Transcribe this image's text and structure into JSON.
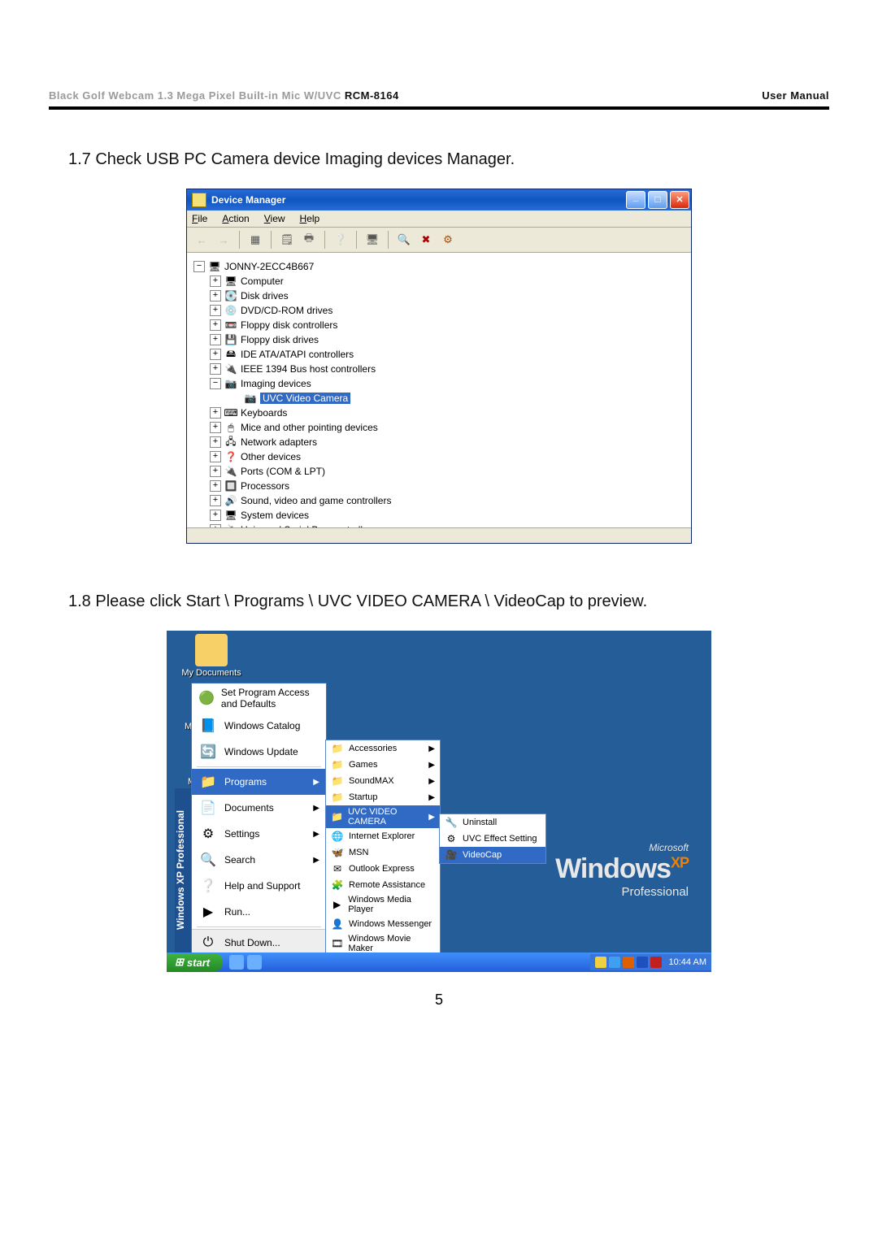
{
  "header": {
    "left_grey": "Black Golf Webcam 1.3 Mega Pixel Built-in Mic W/UVC ",
    "model": "RCM-8164",
    "right": "User Manual"
  },
  "step17": "1.7 Check USB PC Camera device Imaging devices Manager.",
  "device_manager": {
    "title": "Device Manager",
    "menus": {
      "file": "File",
      "action": "Action",
      "view": "View",
      "help": "Help"
    },
    "root": "JONNY-2ECC4B667",
    "items": [
      {
        "label": "Computer",
        "icon": "🖥"
      },
      {
        "label": "Disk drives",
        "icon": "💽"
      },
      {
        "label": "DVD/CD-ROM drives",
        "icon": "💿"
      },
      {
        "label": "Floppy disk controllers",
        "icon": "📼"
      },
      {
        "label": "Floppy disk drives",
        "icon": "💾"
      },
      {
        "label": "IDE ATA/ATAPI controllers",
        "icon": "🖴"
      },
      {
        "label": "IEEE 1394 Bus host controllers",
        "icon": "🔌"
      }
    ],
    "imaging_label": "Imaging devices",
    "imaging_icon": "📷",
    "selected": "UVC Video Camera",
    "items2": [
      {
        "label": "Keyboards",
        "icon": "⌨"
      },
      {
        "label": "Mice and other pointing devices",
        "icon": "🖱"
      },
      {
        "label": "Network adapters",
        "icon": "🖧"
      },
      {
        "label": "Other devices",
        "icon": "❓"
      },
      {
        "label": "Ports (COM & LPT)",
        "icon": "🔌"
      },
      {
        "label": "Processors",
        "icon": "🔲"
      },
      {
        "label": "Sound, video and game controllers",
        "icon": "🔊"
      },
      {
        "label": "System devices",
        "icon": "🖥"
      },
      {
        "label": "Universal Serial Bus controllers",
        "icon": "🔌"
      }
    ]
  },
  "step18": "1.8 Please click Start \\ Programs \\ UVC VIDEO CAMERA \\ VideoCap to preview.",
  "xp": {
    "desktop": {
      "my_documents": "My Documents",
      "my_computer": "My Computer",
      "my_network": "My Network Places"
    },
    "sidebar": "Windows XP Professional",
    "brand": {
      "ms": "Microsoft",
      "win": "Windows",
      "xp": "XP",
      "pro": "Professional"
    },
    "start_top": [
      {
        "label": "Set Program Access and Defaults",
        "icon": "🟢"
      },
      {
        "label": "Windows Catalog",
        "icon": "📘"
      },
      {
        "label": "Windows Update",
        "icon": "🔄"
      }
    ],
    "start_main": [
      {
        "label": "Programs",
        "icon": "📁",
        "arrow": true,
        "selected": true
      },
      {
        "label": "Documents",
        "icon": "📄",
        "arrow": true
      },
      {
        "label": "Settings",
        "icon": "⚙",
        "arrow": true
      },
      {
        "label": "Search",
        "icon": "🔍",
        "arrow": true
      },
      {
        "label": "Help and Support",
        "icon": "❔"
      },
      {
        "label": "Run...",
        "icon": "▶"
      }
    ],
    "start_bottom": [
      {
        "label": "Shut Down...",
        "icon": "⏻"
      }
    ],
    "submenu": [
      {
        "label": "Accessories",
        "icon": "📁",
        "arrow": true
      },
      {
        "label": "Games",
        "icon": "📁",
        "arrow": true
      },
      {
        "label": "SoundMAX",
        "icon": "📁",
        "arrow": true
      },
      {
        "label": "Startup",
        "icon": "📁",
        "arrow": true
      },
      {
        "label": "UVC VIDEO CAMERA",
        "icon": "📁",
        "arrow": true,
        "selected": true
      },
      {
        "label": "Internet Explorer",
        "icon": "🌐"
      },
      {
        "label": "MSN",
        "icon": "🦋"
      },
      {
        "label": "Outlook Express",
        "icon": "✉"
      },
      {
        "label": "Remote Assistance",
        "icon": "🧩"
      },
      {
        "label": "Windows Media Player",
        "icon": "▶"
      },
      {
        "label": "Windows Messenger",
        "icon": "👤"
      },
      {
        "label": "Windows Movie Maker",
        "icon": "🎞"
      }
    ],
    "submenu2": [
      {
        "label": "Uninstall",
        "icon": "🔧"
      },
      {
        "label": "UVC Effect Setting",
        "icon": "⚙"
      },
      {
        "label": "VideoCap",
        "icon": "🎥",
        "selected": true
      }
    ],
    "taskbar": {
      "start": "start",
      "clock": "10:44 AM"
    }
  },
  "page_number": "5"
}
